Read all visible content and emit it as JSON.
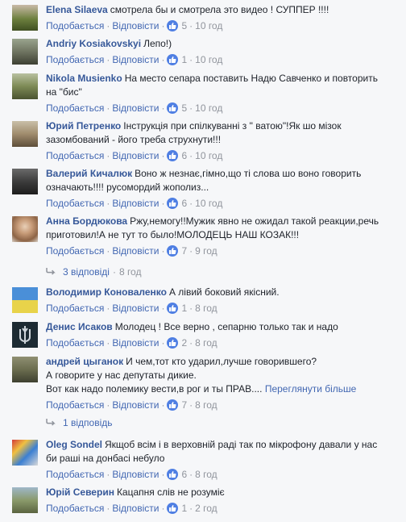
{
  "actions": {
    "like": "Подобається",
    "reply": "Відповісти"
  },
  "comments": [
    {
      "name": "Elena Silaeva",
      "lines": [
        "смотрела бы и смотрела это видео ! СУППЕР !!!!"
      ],
      "likes": "5",
      "time": "10 год"
    },
    {
      "name": "Andriy Kosiakovskyi",
      "lines": [
        "Лепо!)"
      ],
      "likes": "1",
      "time": "10 год"
    },
    {
      "name": "Nikola Musienko",
      "lines": [
        "На место сепара поставить Надю Савченко и повторить",
        "на \"бис\""
      ],
      "likes": "5",
      "time": "10 год"
    },
    {
      "name": "Юрий Петренко",
      "lines": [
        "Інструкція при спілкуванні з \" ватою\"!Як шо мізок",
        "зазомбований - його треба струхнути!!!"
      ],
      "likes": "6",
      "time": "10 год"
    },
    {
      "name": "Валерий Кичалюк",
      "lines": [
        "Воно ж незнає,гімно,що ті слова шо воно говорить",
        "означають!!!! русомордий жополиз..."
      ],
      "likes": "6",
      "time": "10 год"
    },
    {
      "name": "Анна Бордюкова",
      "lines": [
        "Ржу,немогу!!Мужик явно не ожидал такой реакции,речь",
        "приготовил!А не тут то было!МОЛОДЕЦЬ НАШ КОЗАК!!!"
      ],
      "likes": "7",
      "time": "9 год"
    },
    {
      "name": "Володимир Коноваленко",
      "lines": [
        "А лівий боковий якісний."
      ],
      "likes": "1",
      "time": "8 год"
    },
    {
      "name": "Денис Исаков",
      "lines": [
        "Молодец ! Все верно , сепарню только так и надо"
      ],
      "likes": "2",
      "time": "8 год"
    },
    {
      "name": "андрей цыганок",
      "lines": [
        "И чем,тот кто ударил,лучше говорившего?",
        "А говорите у нас депутаты дикие.",
        "Вот как надо полемику вести,в рог и ты ПРАВ...."
      ],
      "more": "Переглянути більше",
      "likes": "7",
      "time": "8 год"
    },
    {
      "name": "Oleg Sondel",
      "lines": [
        "Якщоб всім і в верховній раді так по мікрофону давали у нас",
        "би раші на донбасі небуло"
      ],
      "likes": "6",
      "time": "8 год"
    },
    {
      "name": "Юрій Северин",
      "lines": [
        "Кацапня слів не розуміє"
      ],
      "likes": "1",
      "time": "2 год"
    }
  ],
  "replies": [
    {
      "label": "3 відповіді",
      "time": "8 год"
    },
    {
      "label": "1 відповідь"
    }
  ],
  "colors": {
    "link": "#4267b2",
    "name": "#365899",
    "meta": "#90949c",
    "like_badge": "#4f7fe3",
    "background": "#f6f7f9"
  }
}
